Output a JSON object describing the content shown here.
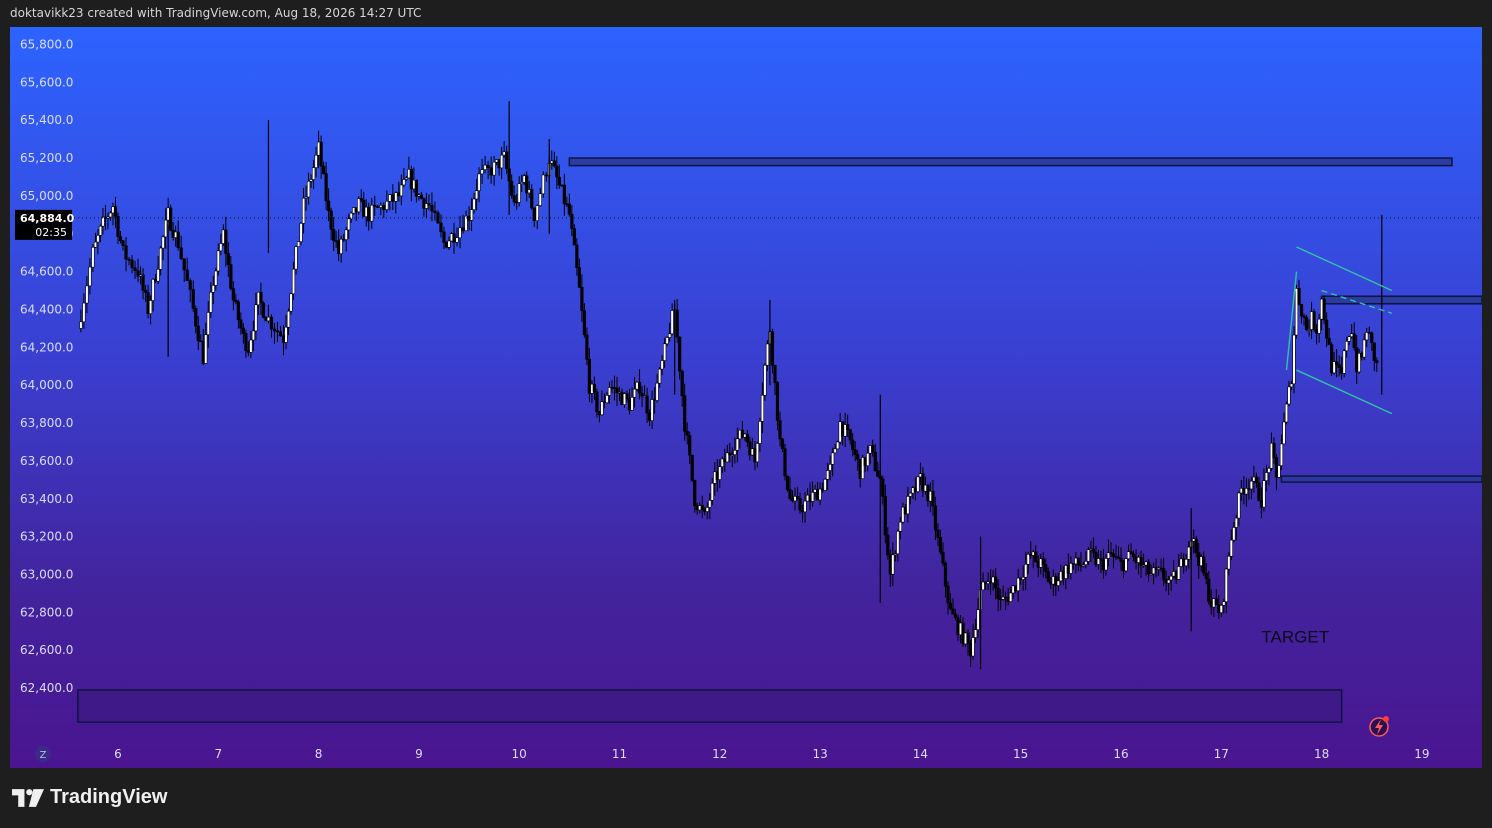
{
  "header": {
    "attribution": "doktavikk23 created with TradingView.com, Aug 18, 2026 14:27 UTC"
  },
  "footer": {
    "brand": "TradingView"
  },
  "colors": {
    "candle": "#000000",
    "candle_wick": "#000000",
    "candle_body_up": "#ffffff",
    "zone_fill": "#2a3a9a",
    "zone_stroke": "#0c1540",
    "target_zone_fill": "#3d1a85",
    "channel": "#2ec4a6",
    "price_label_bg": "#000000"
  },
  "chart_data": {
    "type": "candlestick",
    "ylim": [
      62300,
      65850
    ],
    "yticks": [
      65800,
      65600,
      65400,
      65200,
      65000,
      64800,
      64600,
      64400,
      64200,
      64000,
      63800,
      63600,
      63400,
      63200,
      63000,
      62800,
      62600,
      62400
    ],
    "ytick_labels": [
      "65,800.0",
      "65,600.0",
      "65,400.0",
      "65,200.0",
      "65,000.0",
      "64,800.0",
      "64,600.0",
      "64,400.0",
      "64,200.0",
      "64,000.0",
      "63,800.0",
      "63,600.0",
      "63,400.0",
      "63,200.0",
      "63,000.0",
      "62,800.0",
      "62,600.0",
      "62,400.0"
    ],
    "xlim": [
      5.4,
      19.6
    ],
    "xticks": [
      6,
      7,
      8,
      9,
      10,
      11,
      12,
      13,
      14,
      15,
      16,
      17,
      18,
      19
    ],
    "xtick_labels": [
      "6",
      "7",
      "8",
      "9",
      "10",
      "11",
      "12",
      "13",
      "14",
      "15",
      "16",
      "17",
      "18",
      "19"
    ],
    "last_price": 64884,
    "last_price_label": "64,884.0",
    "countdown_label": "02:35",
    "timezone_badge": "Z",
    "path": [
      [
        5.6,
        64300
      ],
      [
        5.75,
        64700
      ],
      [
        5.85,
        64850
      ],
      [
        5.95,
        64950
      ],
      [
        6.05,
        64700
      ],
      [
        6.2,
        64600
      ],
      [
        6.3,
        64400
      ],
      [
        6.4,
        64650
      ],
      [
        6.5,
        64900
      ],
      [
        6.6,
        64750
      ],
      [
        6.75,
        64400
      ],
      [
        6.85,
        64150
      ],
      [
        6.95,
        64550
      ],
      [
        7.05,
        64800
      ],
      [
        7.15,
        64450
      ],
      [
        7.25,
        64250
      ],
      [
        7.3,
        64200
      ],
      [
        7.4,
        64450
      ],
      [
        7.5,
        64350
      ],
      [
        7.65,
        64250
      ],
      [
        7.75,
        64600
      ],
      [
        7.85,
        64950
      ],
      [
        7.95,
        65150
      ],
      [
        8.0,
        65250
      ],
      [
        8.1,
        64900
      ],
      [
        8.2,
        64700
      ],
      [
        8.3,
        64850
      ],
      [
        8.4,
        64950
      ],
      [
        8.5,
        64900
      ],
      [
        8.65,
        64950
      ],
      [
        8.8,
        65000
      ],
      [
        8.9,
        65100
      ],
      [
        9.0,
        65000
      ],
      [
        9.1,
        64950
      ],
      [
        9.25,
        64750
      ],
      [
        9.35,
        64800
      ],
      [
        9.5,
        64900
      ],
      [
        9.6,
        65100
      ],
      [
        9.75,
        65150
      ],
      [
        9.85,
        65200
      ],
      [
        9.95,
        64950
      ],
      [
        10.05,
        65100
      ],
      [
        10.15,
        64900
      ],
      [
        10.3,
        65200
      ],
      [
        10.4,
        65050
      ],
      [
        10.5,
        64900
      ],
      [
        10.6,
        64500
      ],
      [
        10.7,
        64000
      ],
      [
        10.8,
        63850
      ],
      [
        10.9,
        64000
      ],
      [
        11.0,
        63950
      ],
      [
        11.1,
        63900
      ],
      [
        11.2,
        64000
      ],
      [
        11.3,
        63850
      ],
      [
        11.4,
        64050
      ],
      [
        11.5,
        64300
      ],
      [
        11.55,
        64400
      ],
      [
        11.65,
        63800
      ],
      [
        11.75,
        63400
      ],
      [
        11.85,
        63300
      ],
      [
        11.95,
        63500
      ],
      [
        12.05,
        63600
      ],
      [
        12.15,
        63700
      ],
      [
        12.25,
        63750
      ],
      [
        12.35,
        63600
      ],
      [
        12.45,
        64100
      ],
      [
        12.5,
        64300
      ],
      [
        12.6,
        63700
      ],
      [
        12.7,
        63400
      ],
      [
        12.8,
        63350
      ],
      [
        12.9,
        63400
      ],
      [
        13.0,
        63450
      ],
      [
        13.1,
        63550
      ],
      [
        13.2,
        63800
      ],
      [
        13.3,
        63700
      ],
      [
        13.4,
        63550
      ],
      [
        13.5,
        63650
      ],
      [
        13.6,
        63500
      ],
      [
        13.7,
        63000
      ],
      [
        13.8,
        63300
      ],
      [
        13.9,
        63400
      ],
      [
        14.0,
        63500
      ],
      [
        14.1,
        63400
      ],
      [
        14.2,
        63100
      ],
      [
        14.3,
        62800
      ],
      [
        14.4,
        62700
      ],
      [
        14.5,
        62600
      ],
      [
        14.6,
        62900
      ],
      [
        14.7,
        63000
      ],
      [
        14.8,
        62850
      ],
      [
        14.9,
        62900
      ],
      [
        15.0,
        63000
      ],
      [
        15.1,
        63100
      ],
      [
        15.2,
        63050
      ],
      [
        15.3,
        62950
      ],
      [
        15.4,
        63000
      ],
      [
        15.5,
        63050
      ],
      [
        15.6,
        63050
      ],
      [
        15.7,
        63100
      ],
      [
        15.8,
        63050
      ],
      [
        15.9,
        63100
      ],
      [
        16.0,
        63050
      ],
      [
        16.1,
        63100
      ],
      [
        16.2,
        63050
      ],
      [
        16.3,
        63000
      ],
      [
        16.4,
        63000
      ],
      [
        16.5,
        62950
      ],
      [
        16.6,
        63050
      ],
      [
        16.7,
        63200
      ],
      [
        16.8,
        63050
      ],
      [
        16.9,
        62850
      ],
      [
        17.0,
        62800
      ],
      [
        17.1,
        63200
      ],
      [
        17.2,
        63450
      ],
      [
        17.3,
        63500
      ],
      [
        17.4,
        63400
      ],
      [
        17.5,
        63650
      ],
      [
        17.55,
        63500
      ],
      [
        17.6,
        63700
      ],
      [
        17.7,
        64050
      ],
      [
        17.75,
        64500
      ],
      [
        17.8,
        64400
      ],
      [
        17.85,
        64300
      ],
      [
        17.9,
        64350
      ],
      [
        17.95,
        64300
      ],
      [
        18.0,
        64450
      ],
      [
        18.1,
        64100
      ],
      [
        18.2,
        64050
      ],
      [
        18.25,
        64250
      ],
      [
        18.3,
        64300
      ],
      [
        18.35,
        64100
      ],
      [
        18.4,
        64150
      ],
      [
        18.45,
        64300
      ],
      [
        18.5,
        64200
      ],
      [
        18.55,
        64100
      ]
    ],
    "spikes": [
      [
        6.5,
        64850,
        64150
      ],
      [
        7.5,
        65400,
        64700
      ],
      [
        9.9,
        65500,
        64900
      ],
      [
        10.3,
        65300,
        64800
      ],
      [
        11.55,
        64450,
        63950
      ],
      [
        12.5,
        64450,
        64000
      ],
      [
        13.6,
        63950,
        62850
      ],
      [
        14.6,
        63200,
        62500
      ],
      [
        16.7,
        63350,
        62700
      ],
      [
        18.6,
        64900,
        63950
      ]
    ],
    "annotations": {
      "target_label": "TARGET",
      "resistance_zone": {
        "x0": 10.5,
        "x1": 19.3,
        "y0": 65160,
        "y1": 65200
      },
      "zone_mid": {
        "x0": 18.0,
        "x1": 19.6,
        "y0": 64430,
        "y1": 64470
      },
      "zone_low": {
        "x0": 17.6,
        "x1": 19.6,
        "y0": 63490,
        "y1": 63520
      },
      "target_zone": {
        "x0": 5.6,
        "x1": 18.2,
        "y0": 62220,
        "y1": 62390
      },
      "channel_upper": [
        [
          17.75,
          64730
        ],
        [
          18.7,
          64500
        ]
      ],
      "channel_lower": [
        [
          17.75,
          64080
        ],
        [
          18.7,
          63850
        ]
      ],
      "channel_mid": [
        [
          18.0,
          64500
        ],
        [
          18.7,
          64380
        ]
      ],
      "channel_left_edge": [
        [
          17.65,
          64080
        ],
        [
          17.75,
          64600
        ]
      ]
    }
  }
}
